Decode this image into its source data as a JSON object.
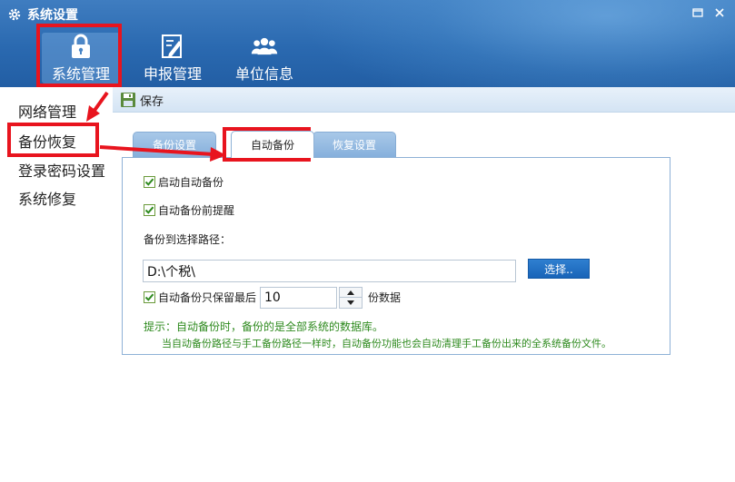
{
  "window": {
    "title": "系统设置",
    "icon": "gear-icon",
    "controls": [
      "restore-icon",
      "close-icon"
    ]
  },
  "nav": {
    "items": [
      {
        "label": "系统管理",
        "icon": "lock-icon",
        "selected": true
      },
      {
        "label": "申报管理",
        "icon": "report-edit-icon",
        "selected": false
      },
      {
        "label": "单位信息",
        "icon": "users-icon",
        "selected": false
      }
    ]
  },
  "sidebar": {
    "items": [
      {
        "label": "网络管理"
      },
      {
        "label": "备份恢复",
        "selected": true
      },
      {
        "label": "登录密码设置"
      },
      {
        "label": "系统修复"
      }
    ]
  },
  "toolbar": {
    "save_label": "保存",
    "save_icon": "save-icon"
  },
  "tabs": [
    {
      "label": "备份设置",
      "active": false
    },
    {
      "label": "自动备份",
      "active": true
    },
    {
      "label": "恢复设置",
      "active": false
    }
  ],
  "auto_backup": {
    "enable_label": "启动自动备份",
    "enable_checked": true,
    "remind_label": "自动备份前提醒",
    "remind_checked": true,
    "path_label": "备份到选择路径：",
    "path_value": "D:\\个税\\",
    "choose_label": "选择..",
    "keep_label": "自动备份只保留最后",
    "keep_checked": true,
    "keep_value": "10",
    "keep_unit": "份数据",
    "hint_line1": "提示：自动备份时，备份的是全部系统的数据库。",
    "hint_line2": "当自动备份路径与手工备份路径一样时，自动备份功能也会自动清理手工备份出来的全系统备份文件。"
  },
  "colors": {
    "header_blue": "#2a69b0",
    "annotation_red": "#e8141e",
    "hint_green": "#2e8a1e",
    "button_blue": "#1864b8"
  }
}
